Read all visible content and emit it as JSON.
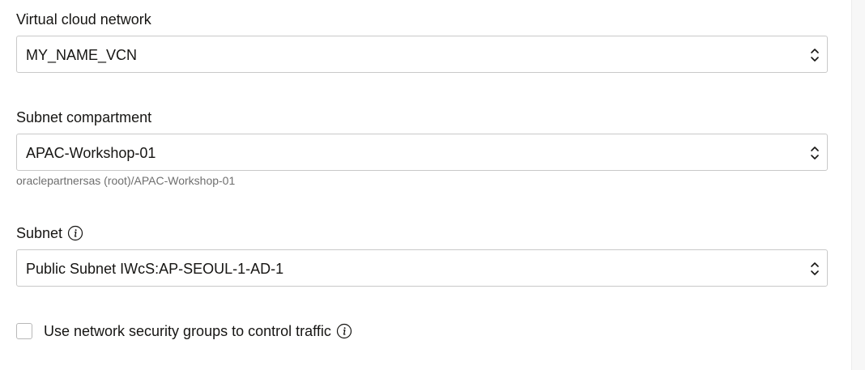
{
  "vcn": {
    "label": "Virtual cloud network",
    "value": "MY_NAME_VCN"
  },
  "subnet_compartment": {
    "label": "Subnet compartment",
    "value": "APAC-Workshop-01",
    "helper": "oraclepartnersas (root)/APAC-Workshop-01"
  },
  "subnet": {
    "label": "Subnet",
    "value": "Public Subnet IWcS:AP-SEOUL-1-AD-1",
    "info_icon": "info-icon"
  },
  "nsg": {
    "label": "Use network security groups to control traffic",
    "checked": false,
    "info_icon": "info-icon"
  },
  "icons": {
    "select_indicator": "chevron-up-down-icon"
  }
}
